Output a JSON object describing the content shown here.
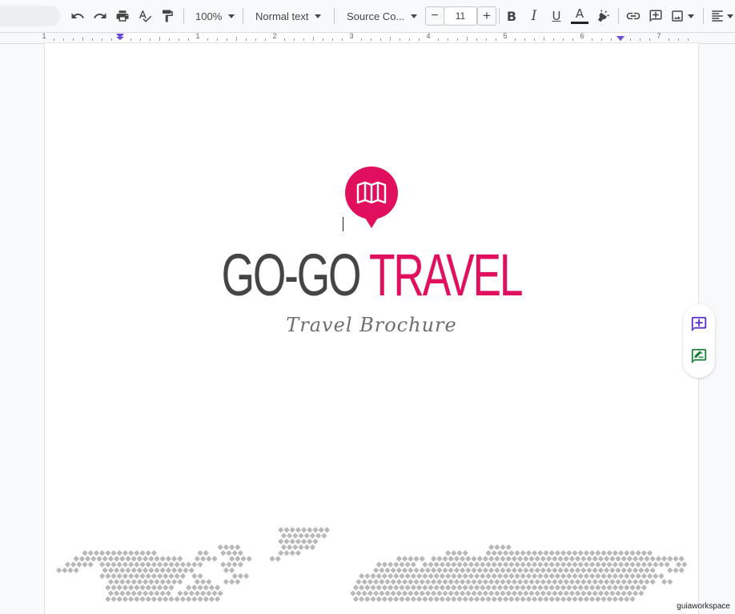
{
  "toolbar": {
    "zoom": "100%",
    "paragraph_style": "Normal text",
    "font": "Source Co...",
    "font_size": "11",
    "decrease_size": "−",
    "increase_size": "+",
    "bold_label": "B",
    "italic_label": "I",
    "underline_label": "U",
    "text_color_label": "A",
    "text_color": "#202124"
  },
  "ruler": {
    "labels": [
      "1",
      "1",
      "2",
      "3",
      "4",
      "5",
      "6",
      "7"
    ]
  },
  "document": {
    "title_part1": "GO-GO ",
    "title_part2": "TRAVEL",
    "subtitle": "Travel Brochure",
    "accent_color": "#e0105e"
  },
  "icons": {
    "pin": "map-icon",
    "add_comment": "add-comment-icon",
    "suggest_edit": "suggest-edit-icon"
  },
  "watermark": "guiaworkspace"
}
